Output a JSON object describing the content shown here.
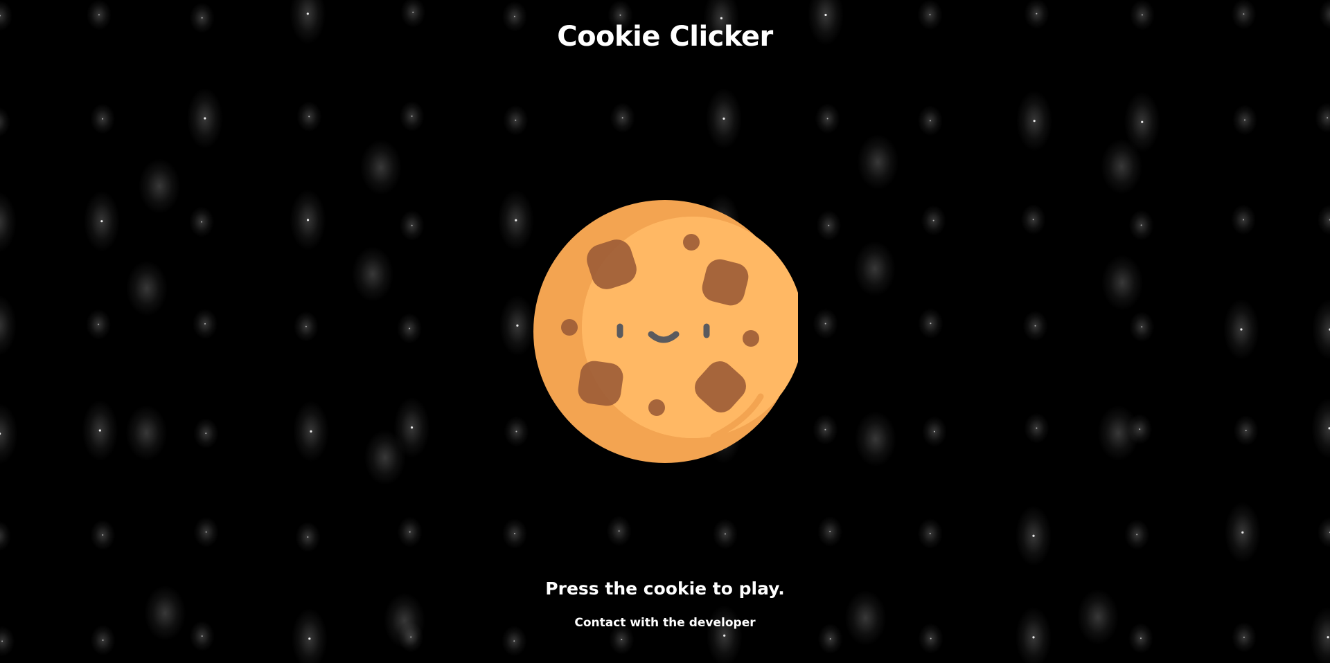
{
  "app": {
    "title": "Cookie Clicker"
  },
  "main": {
    "prompt": "Press the cookie to play.",
    "contact_link": "Contact with the developer"
  },
  "colors": {
    "background": "#000000",
    "cookie_light": "#FFB864",
    "cookie_dark": "#F3A451",
    "chip": "#9C5C36",
    "face": "#5A5A5E",
    "text": "#FFFFFF"
  },
  "icons": {
    "cookie": "cookie-icon"
  }
}
